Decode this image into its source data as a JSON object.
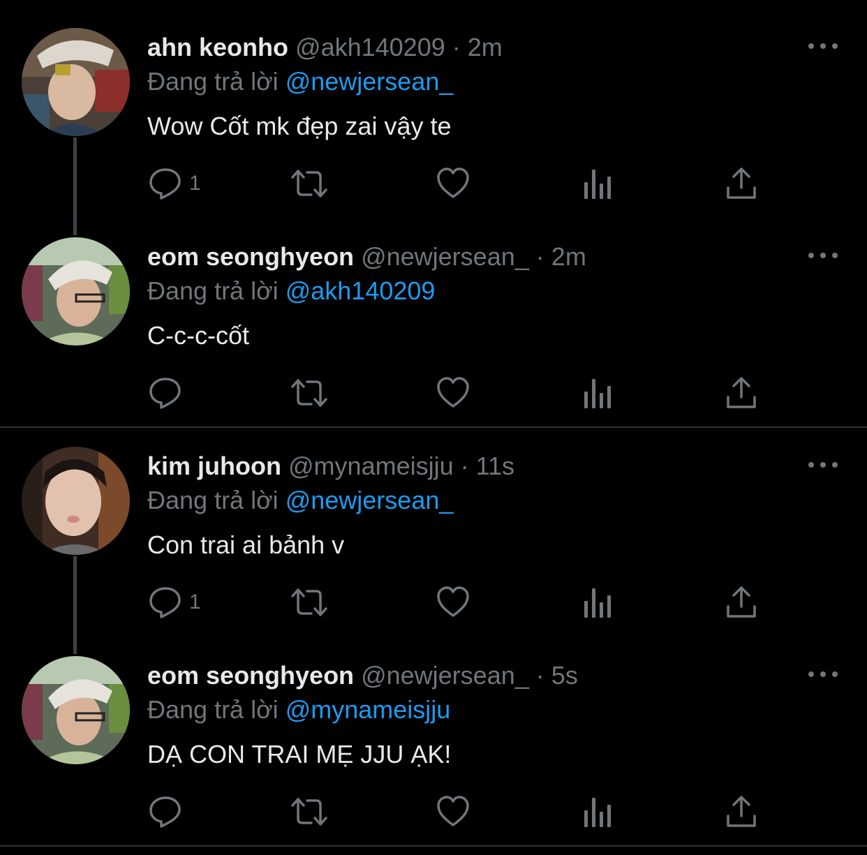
{
  "reply_prefix": "Đang trả lời",
  "separator": "·",
  "tweets": [
    {
      "display_name": "ahn keonho",
      "handle": "@akh140209",
      "time": "2m",
      "reply_to": "@newjersean_",
      "text": "Wow Cốt mk đẹp zai vậy te",
      "reply_count": "1"
    },
    {
      "display_name": "eom seonghyeon",
      "handle": "@newjersean_",
      "time": "2m",
      "reply_to": "@akh140209",
      "text": "C-c-c-cốt",
      "reply_count": ""
    },
    {
      "display_name": "kim juhoon",
      "handle": "@mynameisjju",
      "time": "11s",
      "reply_to": "@newjersean_",
      "text": "Con trai ai bảnh v",
      "reply_count": "1"
    },
    {
      "display_name": "eom seonghyeon",
      "handle": "@newjersean_",
      "time": "5s",
      "reply_to": "@mynameisjju",
      "text": "DẠ CON TRAI MẸ JJU ẠK!",
      "reply_count": ""
    }
  ],
  "icons": {
    "reply": "speech-bubble-icon",
    "retweet": "retweet-arrows-icon",
    "like": "heart-icon",
    "analytics": "bar-chart-icon",
    "share": "share-upload-icon",
    "more": "ellipsis-icon"
  },
  "colors": {
    "background": "#000000",
    "primary_text": "#e7e9ea",
    "secondary_text": "#71767b",
    "link": "#1d9bf0",
    "divider": "#2f3336"
  }
}
